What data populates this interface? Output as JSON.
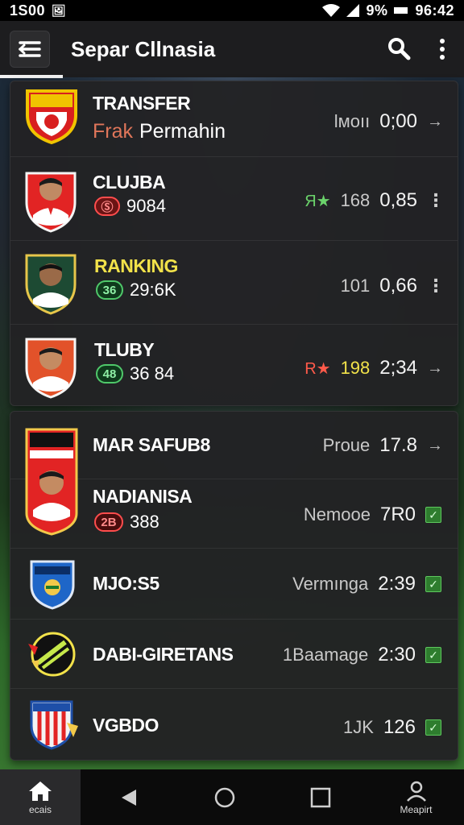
{
  "status_bar": {
    "time": "1S00",
    "battery": "9%",
    "clock": "96:42"
  },
  "app_bar": {
    "title": "Separ Cllnasia"
  },
  "colors": {
    "accent_green": "#6bd36b",
    "accent_red": "#ff5a4a",
    "accent_yellow": "#f2e24a",
    "card_bg": "#222224"
  },
  "card_top": {
    "rows": [
      {
        "title": "TRANSFER",
        "subtitle_a": "Frak",
        "subtitle_b": "Permahin",
        "label": "lмoıı",
        "value": "0;00",
        "trail": "→"
      },
      {
        "title": "CLUJBA",
        "badge": "Ⓢ",
        "stat": "9084",
        "label": "Я★",
        "count": "168",
        "value": "0,85",
        "trail": "⋮"
      },
      {
        "title": "RANKING",
        "badge": "36",
        "stat": "29:6K",
        "count": "101",
        "value": "0,66",
        "trail": "⋮"
      },
      {
        "title": "TLUBY",
        "badge": "48",
        "stat": "36 84",
        "label": "R★",
        "count": "198",
        "value": "2;34",
        "trail": "→"
      }
    ]
  },
  "card_bottom": {
    "rows": [
      {
        "title": "MAR SAFUB8",
        "label": "Proue",
        "value": "17.8",
        "trail": "→"
      },
      {
        "title": "NADIANISA",
        "badge": "2B",
        "stat": "388",
        "label": "Nemooe",
        "value": "7R0",
        "trail": "✓"
      },
      {
        "title": "MJO:S5",
        "label": "Vermınga",
        "value": "2:39",
        "trail": "✓"
      },
      {
        "title": "DABI-GIRETANS",
        "label": "1Baamage",
        "value": "2:30",
        "trail": "✓"
      },
      {
        "title": "VGBDO",
        "label": "1JK",
        "value": "126",
        "trail": "✓"
      }
    ]
  },
  "nav": {
    "home_label": "ecais",
    "profile_label": "Meapirt"
  }
}
